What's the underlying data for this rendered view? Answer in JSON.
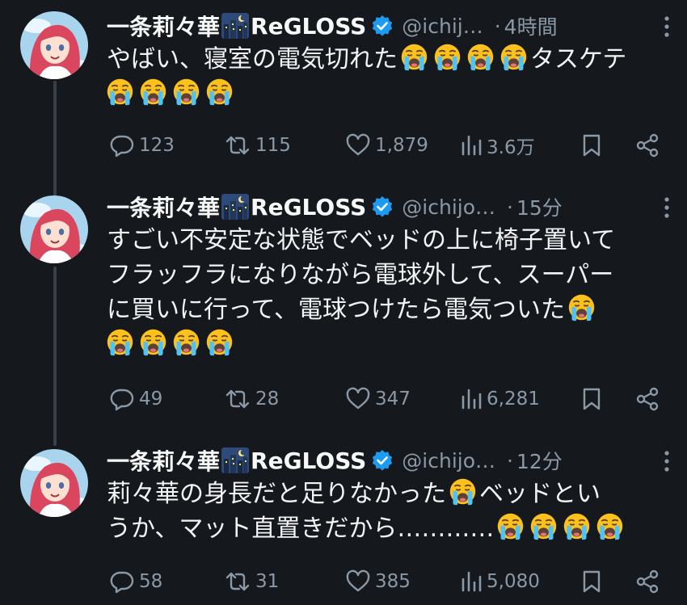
{
  "tweets": [
    {
      "display_name": "一条莉々華",
      "group": "ReGLOSS",
      "handle": "@ichij…",
      "time": "4時間",
      "text_line1": "やばい、寝室の電気切れた",
      "text_after_emojis": "タスケテ",
      "replies": "123",
      "reposts": "115",
      "likes": "1,879",
      "views": "3.6万"
    },
    {
      "display_name": "一条莉々華",
      "group": "ReGLOSS",
      "handle": "@ichijo…",
      "time": "15分",
      "text_line1": "すごい不安定な状態でベッドの上に椅子置いて",
      "text_line2": "フラッフラになりながら電球外して、スーパー",
      "text_line3": "に買いに行って、電球つけたら電気ついた",
      "replies": "49",
      "reposts": "28",
      "likes": "347",
      "views": "6,281"
    },
    {
      "display_name": "一条莉々華",
      "group": "ReGLOSS",
      "handle": "@ichijo…",
      "time": "12分",
      "text_line1": "莉々華の身長だと足りなかった",
      "text_line1_after": "ベッドとい",
      "text_line2": "うか、マット直置きだから…………",
      "replies": "58",
      "reposts": "31",
      "likes": "385",
      "views": "5,080"
    }
  ],
  "separator": "·",
  "icons": [
    "reply-icon",
    "repost-icon",
    "like-icon",
    "views-icon",
    "bookmark-icon",
    "share-icon",
    "verified-badge-icon",
    "more-icon",
    "crying-emoji-icon",
    "night-city-emoji-icon"
  ],
  "colors": {
    "background": "#15181c",
    "text": "#e7e9ea",
    "secondary": "#8b98a5",
    "verified": "#1d9bf0",
    "thread_line": "#3a4047"
  }
}
